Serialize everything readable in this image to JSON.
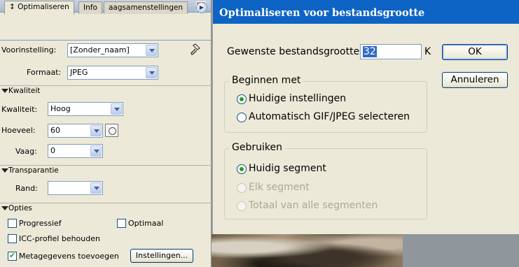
{
  "palette": {
    "tabs": [
      {
        "label": "↕ Optimaliseren"
      },
      {
        "label": "Info"
      },
      {
        "label": "aagsamenstellingen"
      }
    ],
    "preset_label": "Voorinstelling:",
    "preset_value": "[Zonder_naam]",
    "format_label": "Formaat:",
    "format_value": "JPEG",
    "quality_section": "Kwaliteit",
    "quality_label": "Kwaliteit:",
    "quality_value": "Hoog",
    "amount_label": "Hoeveel:",
    "amount_value": "60",
    "blur_label": "Vaag:",
    "blur_value": "0",
    "transparency_section": "Transparantie",
    "matte_label": "Rand:",
    "matte_value": "",
    "options_section": "Opties",
    "progressive_label": "Progressief",
    "progressive_checked": false,
    "optimized_label": "Optimaal",
    "optimized_checked": false,
    "icc_label": "ICC-profiel behouden",
    "icc_checked": false,
    "metadata_label": "Metagegevens toevoegen",
    "metadata_checked": true,
    "settings_button": "Instellingen..."
  },
  "dialog": {
    "title": "Optimaliseren voor bestandsgrootte",
    "desired_size_label": "Gewenste bestandsgrootte:",
    "desired_size_value": "32",
    "unit": "K",
    "ok_button": "OK",
    "cancel_button": "Annuleren",
    "start_with_group": "Beginnen met",
    "start_options": [
      {
        "label": "Huidige instellingen",
        "selected": true,
        "disabled": false
      },
      {
        "label": "Automatisch GIF/JPEG selecteren",
        "selected": false,
        "disabled": false
      }
    ],
    "use_group": "Gebruiken",
    "use_options": [
      {
        "label": "Huidig segment",
        "selected": true,
        "disabled": false
      },
      {
        "label": "Elk segment",
        "selected": false,
        "disabled": true
      },
      {
        "label": "Totaal van alle segmenten",
        "selected": false,
        "disabled": true
      }
    ]
  },
  "colors": {
    "dialog_title_bg": "#0d64c4",
    "panel_bg": "#ece9d8",
    "selection": "#316ac5"
  }
}
